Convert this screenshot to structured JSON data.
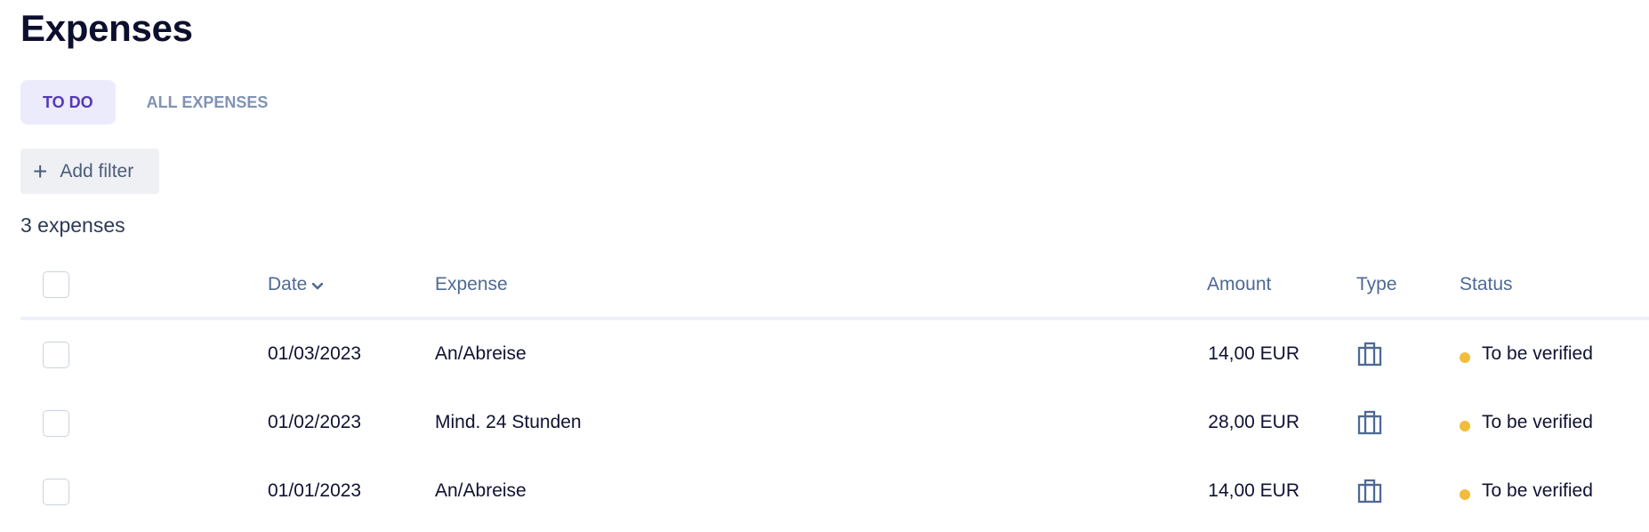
{
  "page": {
    "title": "Expenses"
  },
  "tabs": [
    {
      "label": "TO DO",
      "active": true
    },
    {
      "label": "ALL EXPENSES",
      "active": false
    }
  ],
  "filter": {
    "label": "Add filter",
    "icon": "plus-icon"
  },
  "summary": {
    "count_text": "3 expenses"
  },
  "table": {
    "columns": {
      "date": "Date",
      "expense": "Expense",
      "amount": "Amount",
      "type": "Type",
      "status": "Status"
    },
    "sort": {
      "column": "date",
      "direction": "desc",
      "icon": "chevron-down-icon"
    },
    "rows": [
      {
        "date": "01/03/2023",
        "expense": "An/Abreise",
        "amount": "14,00 EUR",
        "type_icon": "briefcase-icon",
        "status": "To be verified"
      },
      {
        "date": "01/02/2023",
        "expense": "Mind. 24 Stunden",
        "amount": "28,00 EUR",
        "type_icon": "briefcase-icon",
        "status": "To be verified"
      },
      {
        "date": "01/01/2023",
        "expense": "An/Abreise",
        "amount": "14,00 EUR",
        "type_icon": "briefcase-icon",
        "status": "To be verified"
      }
    ]
  },
  "colors": {
    "accent": "#5539b4",
    "accent_bg": "#ecebfc",
    "status_pending": "#f2bd3b",
    "header_text": "#4e6a93"
  }
}
